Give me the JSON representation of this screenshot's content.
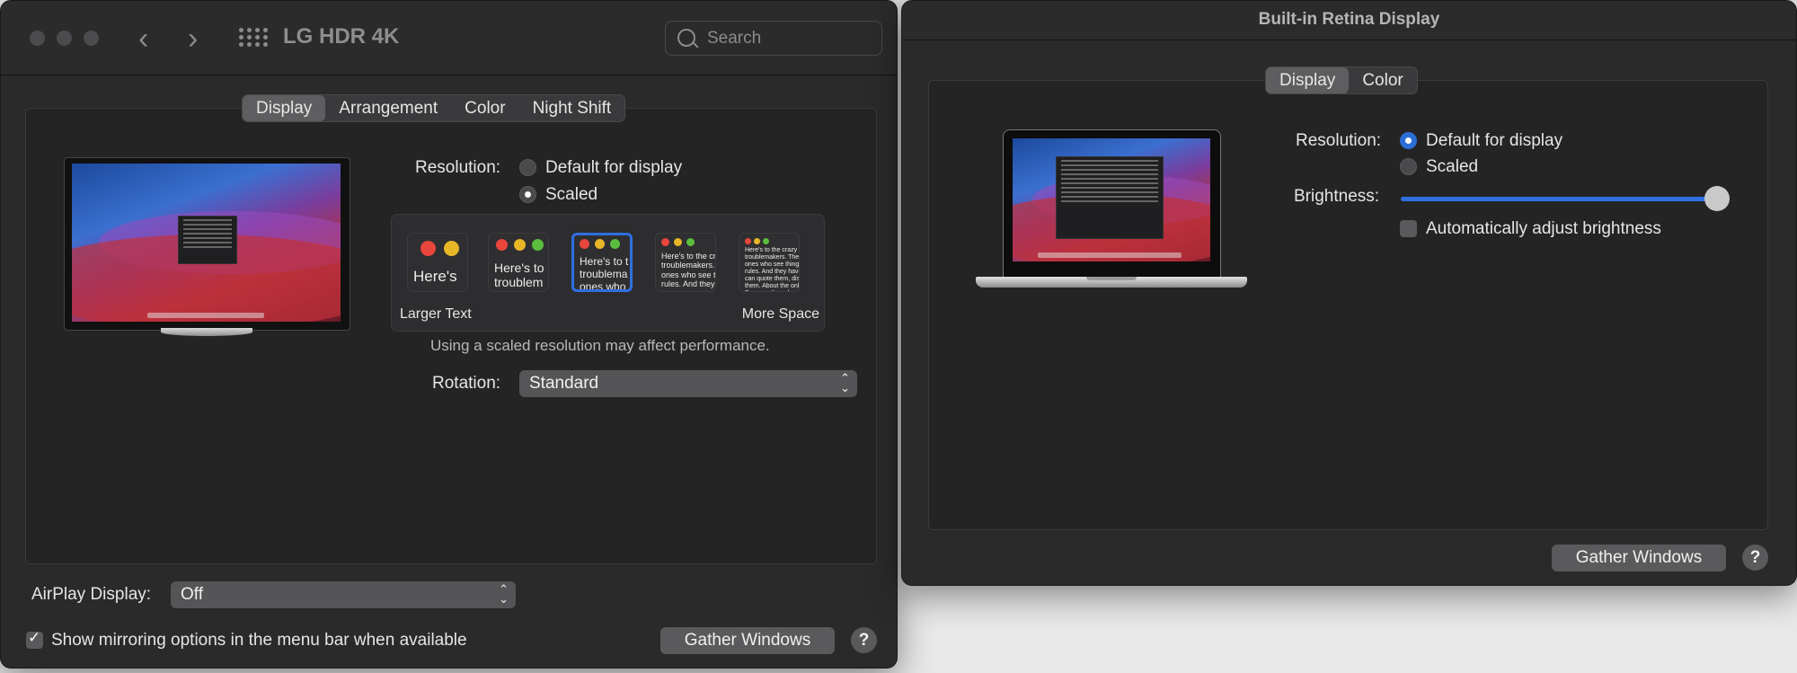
{
  "left_window": {
    "title": "LG HDR 4K",
    "search_placeholder": "Search",
    "tabs": [
      "Display",
      "Arrangement",
      "Color",
      "Night Shift"
    ],
    "active_tab": "Display",
    "resolution_label": "Resolution:",
    "resolution_options": [
      "Default for display",
      "Scaled"
    ],
    "resolution_selected": "Scaled",
    "scale_thumbs": [
      "Here's",
      "Here's to\ntroublem",
      "Here's to t\ntroublema\nones who",
      "Here's to the cr\ntroublemakers.\nones who see t\nrules. And they",
      "Here's to the crazy one\ntroublemakers. The rou\nones who see things dif\nrules. And they have no\ncan quote them, disagr\nthem. About the only th\nBecause they change th"
    ],
    "selected_thumb_index": 2,
    "larger_text_label": "Larger Text",
    "more_space_label": "More Space",
    "scaled_note": "Using a scaled resolution may affect performance.",
    "rotation_label": "Rotation:",
    "rotation_value": "Standard",
    "airplay_label": "AirPlay Display:",
    "airplay_value": "Off",
    "mirroring_label": "Show mirroring options in the menu bar when available",
    "mirroring_checked": true,
    "gather_button": "Gather Windows",
    "help_label": "?"
  },
  "right_window": {
    "title": "Built-in Retina Display",
    "tabs": [
      "Display",
      "Color"
    ],
    "active_tab": "Display",
    "resolution_label": "Resolution:",
    "resolution_options": [
      "Default for display",
      "Scaled"
    ],
    "resolution_selected": "Default for display",
    "brightness_label": "Brightness:",
    "brightness_level": 1.0,
    "auto_brightness_label": "Automatically adjust brightness",
    "auto_brightness_checked": false,
    "gather_button": "Gather Windows",
    "help_label": "?"
  },
  "colors": {
    "accent": "#2f6fe0",
    "window_bg": "#2a2a2b",
    "panel_bg": "#242425"
  }
}
